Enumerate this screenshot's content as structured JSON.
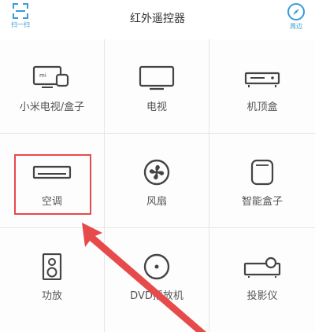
{
  "header": {
    "title": "红外遥控器",
    "scan_label": "扫一扫",
    "nearby_label": "周边"
  },
  "accent_color": "#3a9bd8",
  "highlight_color": "#e74a4a",
  "devices": [
    {
      "label": "小米电视/盒子",
      "icon": "mi-tv-box-icon"
    },
    {
      "label": "电视",
      "icon": "tv-icon"
    },
    {
      "label": "机顶盒",
      "icon": "set-top-box-icon"
    },
    {
      "label": "空调",
      "icon": "air-conditioner-icon"
    },
    {
      "label": "风扇",
      "icon": "fan-icon"
    },
    {
      "label": "智能盒子",
      "icon": "smart-box-icon"
    },
    {
      "label": "功放",
      "icon": "amplifier-icon"
    },
    {
      "label": "DVD播放机",
      "icon": "dvd-player-icon"
    },
    {
      "label": "投影仪",
      "icon": "projector-icon"
    }
  ],
  "highlighted_device": "空调"
}
